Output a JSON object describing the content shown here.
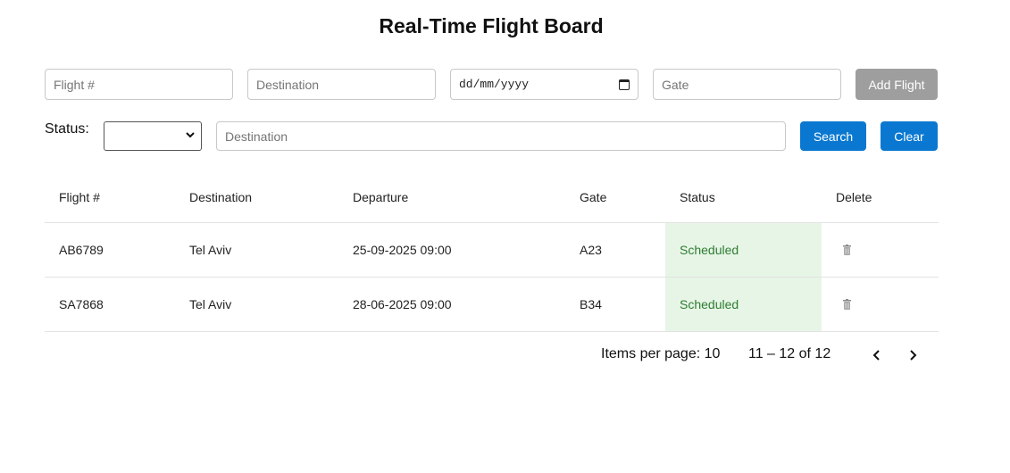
{
  "title": "Real-Time Flight Board",
  "form": {
    "flight_placeholder": "Flight #",
    "destination_placeholder": "Destination",
    "date_placeholder": "dd/mm/yyyy",
    "gate_placeholder": "Gate",
    "add_label": "Add Flight"
  },
  "search": {
    "status_label": "Status:",
    "status_selected": "",
    "destination_placeholder": "Destination",
    "search_label": "Search",
    "clear_label": "Clear"
  },
  "table": {
    "headers": [
      "Flight #",
      "Destination",
      "Departure",
      "Gate",
      "Status",
      "Delete"
    ],
    "rows": [
      {
        "flight": "AB6789",
        "destination": "Tel Aviv",
        "departure": "25-09-2025 09:00",
        "gate": "A23",
        "status": "Scheduled"
      },
      {
        "flight": "SA7868",
        "destination": "Tel Aviv",
        "departure": "28-06-2025 09:00",
        "gate": "B34",
        "status": "Scheduled"
      }
    ]
  },
  "pagination": {
    "items_per_page": "Items per page: 10",
    "range": "11 – 12 of 12"
  },
  "colors": {
    "primary": "#0a78d1",
    "disabled": "#9e9e9e",
    "status_bg": "#e7f5e6",
    "status_text": "#2e7d32"
  }
}
